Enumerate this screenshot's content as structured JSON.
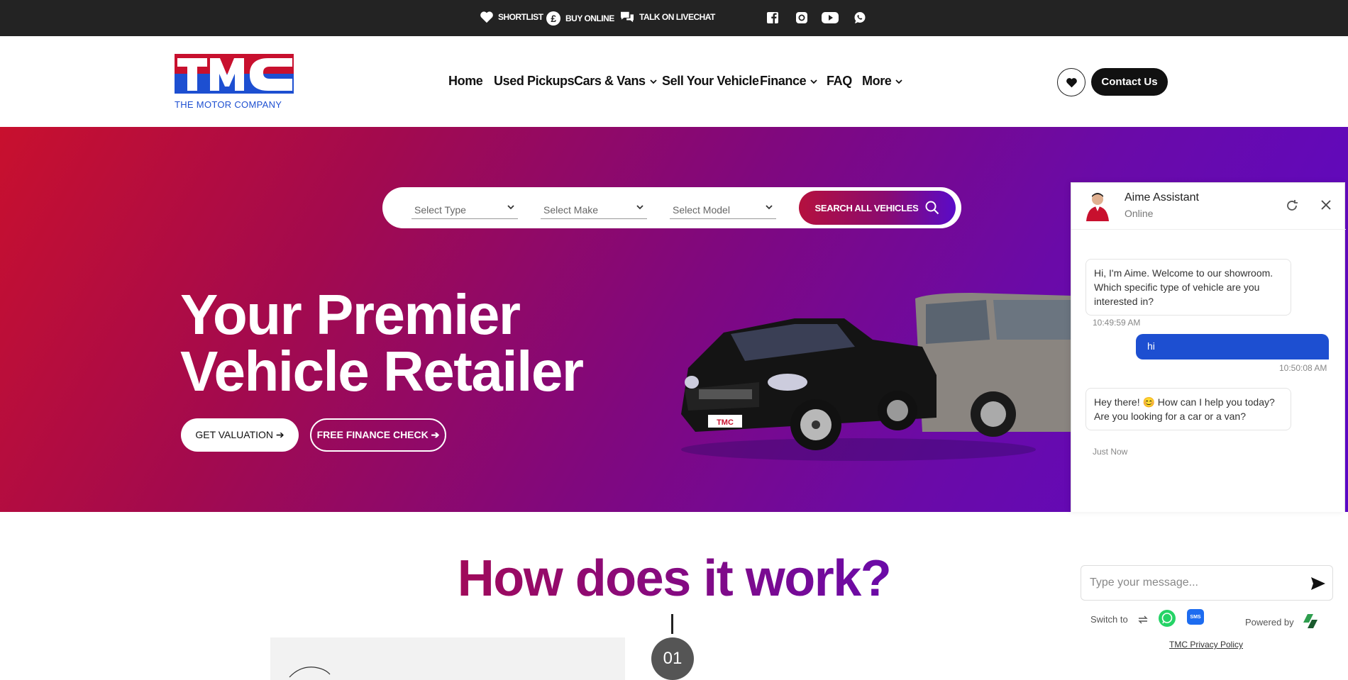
{
  "topbar": {
    "links": [
      {
        "label": "SHORTLIST",
        "icon": "heart-icon"
      },
      {
        "label": "BUY ONLINE",
        "icon": "pound-icon"
      },
      {
        "label": "TALK ON LIVECHAT",
        "icon": "chat-bubbles-icon"
      }
    ],
    "social": [
      "facebook-icon",
      "instagram-icon",
      "youtube-icon",
      "whatsapp-icon"
    ]
  },
  "logo": {
    "mark": "TMC",
    "subtitle": "THE MOTOR COMPANY"
  },
  "nav": {
    "items": [
      {
        "label": "Home",
        "has_dropdown": false
      },
      {
        "label": "Used Pickups",
        "has_dropdown": false
      },
      {
        "label": "Cars & Vans",
        "has_dropdown": true
      },
      {
        "label": "Sell Your Vehicle",
        "has_dropdown": false
      },
      {
        "label": "Finance",
        "has_dropdown": true
      },
      {
        "label": "FAQ",
        "has_dropdown": false
      },
      {
        "label": "More",
        "has_dropdown": true
      }
    ],
    "contact_label": "Contact Us"
  },
  "search": {
    "type_placeholder": "Select Type",
    "make_placeholder": "Select Make",
    "model_placeholder": "Select Model",
    "button_label": "SEARCH ALL VEHICLES"
  },
  "hero": {
    "title_line1": "Your Premier",
    "title_line2": "Vehicle Retailer",
    "valuation_label": "GET VALUATION ➔",
    "finance_label": "FREE FINANCE CHECK ➔",
    "plate_text": "TMC"
  },
  "how": {
    "title": "How does it work?",
    "step_number": "01"
  },
  "chat": {
    "name": "Aime Assistant",
    "status": "Online",
    "messages": [
      {
        "from": "bot",
        "text": "Hi, I'm Aime. Welcome to our showroom. Which specific type of vehicle are you interested in?",
        "time": "10:49:59 AM"
      },
      {
        "from": "user",
        "text": "hi",
        "time": "10:50:08 AM"
      },
      {
        "from": "bot",
        "text": "Hey there! 😊 How can I help you today? Are you looking for a car or a van?",
        "time": "Just Now"
      }
    ],
    "input_placeholder": "Type your message...",
    "switch_label": "Switch to",
    "powered_label": "Powered by",
    "privacy_label": "TMC Privacy Policy",
    "sms_label": "SMS"
  },
  "colors": {
    "brand_red": "#c8102e",
    "brand_purple": "#5b08c8",
    "chat_blue": "#1d4fd1",
    "whatsapp_green": "#25d366"
  }
}
